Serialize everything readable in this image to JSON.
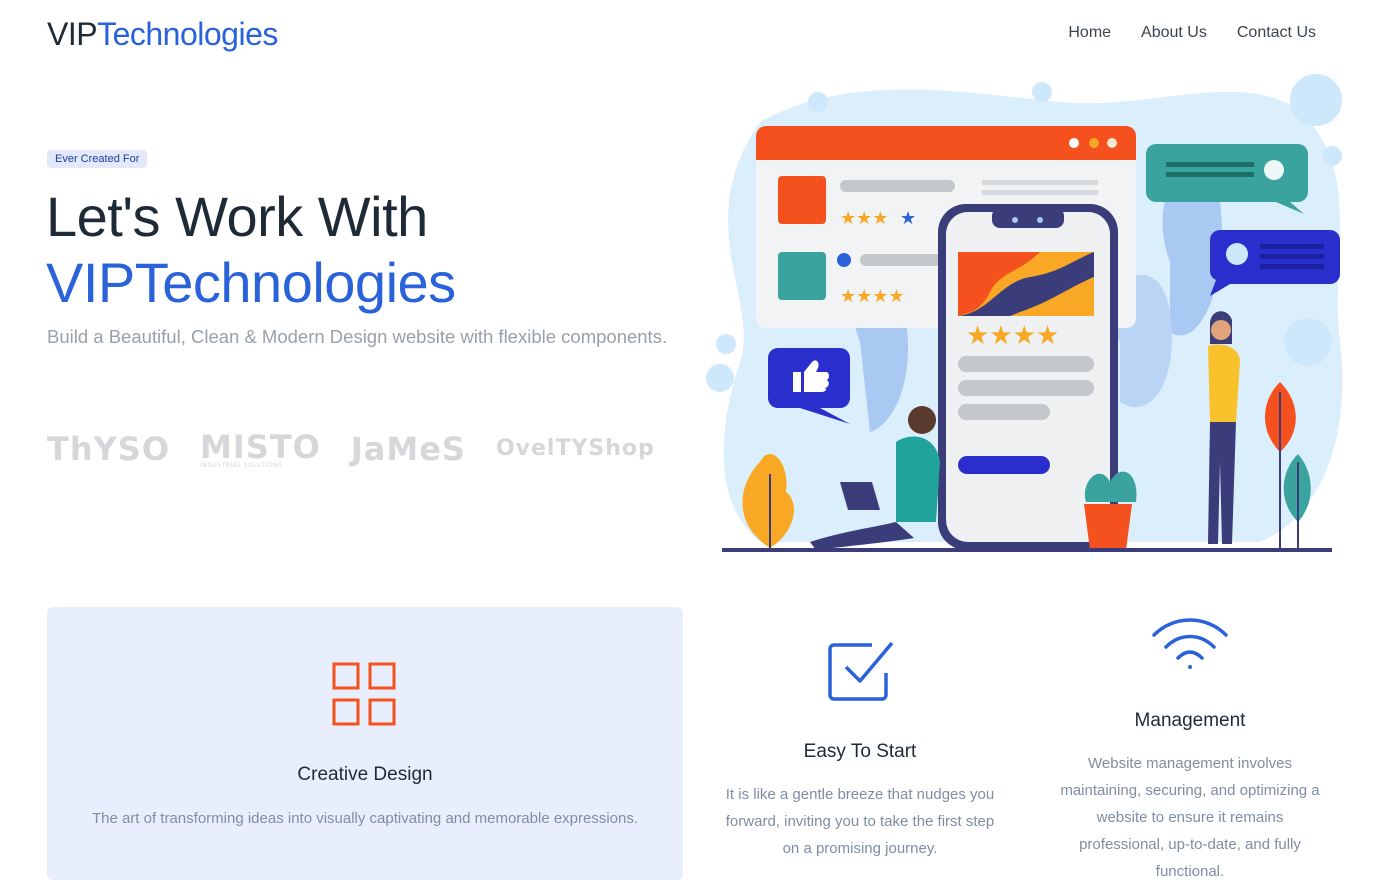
{
  "nav": {
    "brand_prefix": "VIP",
    "brand_accent": "Technologies",
    "links": [
      "Home",
      "About Us",
      "Contact Us"
    ]
  },
  "hero": {
    "badge": "Ever Created For",
    "title_line1": "Let's Work With",
    "title_line2": "VIPTechnologies",
    "subtitle": "Build a Beautiful, Clean & Modern Design website with flexible components."
  },
  "logos": [
    "ThYSO",
    "MISTO",
    "JaMeS",
    "OvelTYShop"
  ],
  "logo_sub": "INDUSTRIAL SOLUTIONS",
  "features": [
    {
      "title": "Creative Design",
      "text": "The art of transforming ideas into visually captivating and memorable expressions."
    },
    {
      "title": "Easy To Start",
      "text": "It is like a gentle breeze that nudges you forward, inviting you to take the first step on a promising journey."
    },
    {
      "title": "Management",
      "text": "Website management involves maintaining, securing, and optimizing a website to ensure it remains professional, up-to-date, and fully functional."
    }
  ],
  "colors": {
    "accent": "#2962d9",
    "orange": "#f4511e",
    "teal": "#3aa39d",
    "navy": "#3b3c7a"
  },
  "icons": [
    "grid-icon",
    "checkbox-icon",
    "wifi-icon"
  ]
}
